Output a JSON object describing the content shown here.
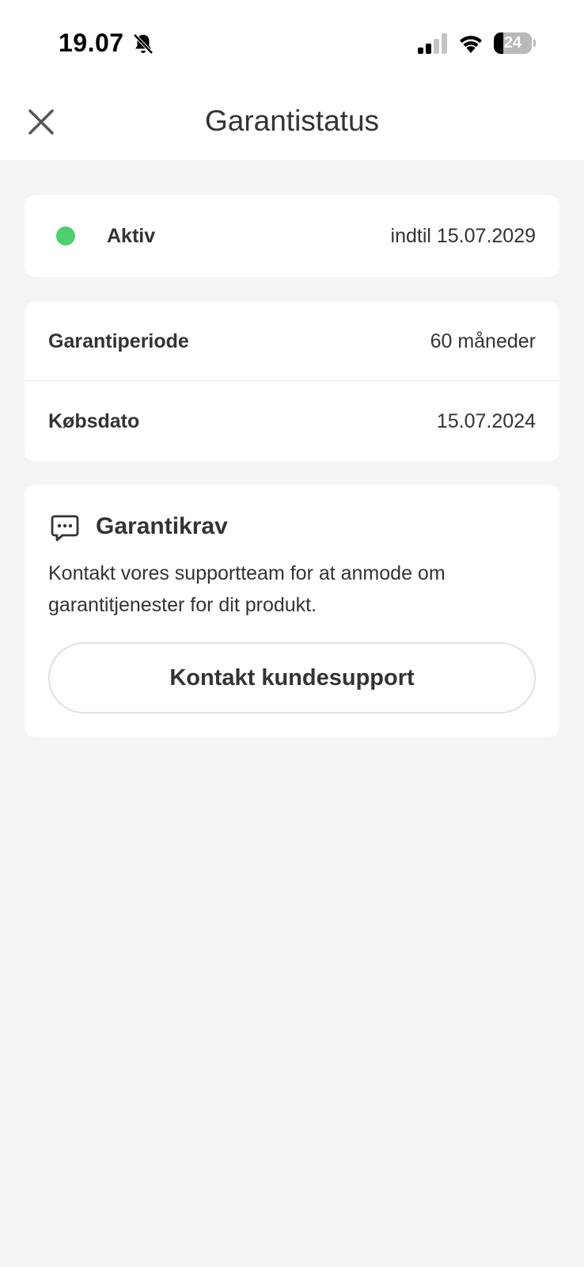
{
  "status_bar": {
    "time": "19.07",
    "battery_level": "24",
    "battery_fraction": 0.24,
    "icons": [
      "bell-slash-icon",
      "signal-icon",
      "wifi-icon",
      "battery-icon"
    ]
  },
  "header": {
    "title": "Garantistatus",
    "close_icon": "close-icon"
  },
  "warranty_status": {
    "label": "Aktiv",
    "until": "indtil 15.07.2029",
    "status_color": "#4fcf70"
  },
  "details": {
    "period_label": "Garantiperiode",
    "period_value": "60 måneder",
    "purchase_label": "Købsdato",
    "purchase_value": "15.07.2024"
  },
  "claim": {
    "icon": "chat-bubble-icon",
    "title": "Garantikrav",
    "description": "Kontakt vores supportteam for at anmode om garantitjenester for dit produkt.",
    "button_label": "Kontakt kundesupport"
  }
}
